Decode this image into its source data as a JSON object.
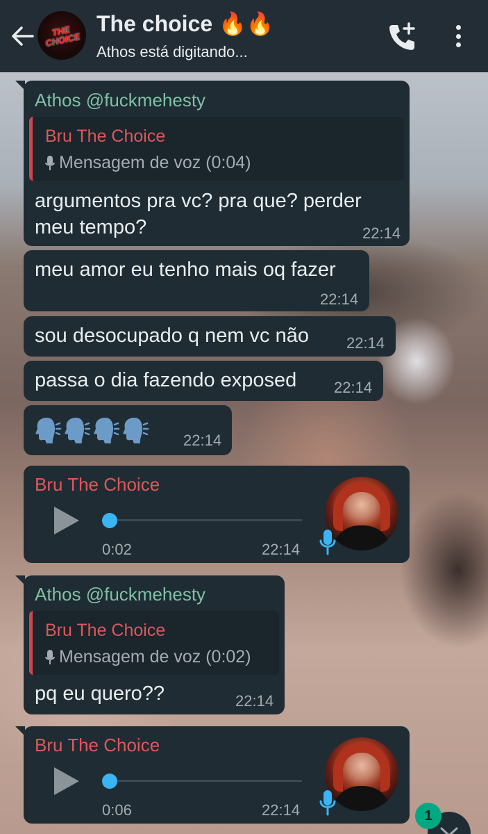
{
  "header": {
    "title": "The choice 🔥🔥",
    "subtitle": "Athos está digitando...",
    "avatar_logo": "THE CHOICE",
    "icons": [
      "back-arrow-icon",
      "add-call-icon",
      "more-vert-icon"
    ]
  },
  "messages": [
    {
      "sender": "Athos @fuckmehesty",
      "quote_sender": "Bru The Choice",
      "quote_text": "Mensagem de voz (0:04)",
      "text": "argumentos pra vc? pra que? perder meu tempo?",
      "time": "22:14"
    },
    {
      "text": "meu amor eu tenho mais oq fazer",
      "time": "22:14"
    },
    {
      "text": "sou desocupado q nem vc não",
      "time": "22:14"
    },
    {
      "text": "passa o dia fazendo exposed",
      "time": "22:14"
    },
    {
      "emoji_count": 4,
      "emoji_name": "speaking-head-emoji",
      "time": "22:14"
    },
    {
      "sender": "Bru The Choice",
      "voice_duration": "0:02",
      "voice_progress": 0,
      "time": "22:14"
    },
    {
      "sender": "Athos @fuckmehesty",
      "quote_sender": "Bru The Choice",
      "quote_text": "Mensagem de voz (0:02)",
      "text": "pq eu quero??",
      "time": "22:14"
    },
    {
      "sender": "Bru The Choice",
      "voice_duration": "0:06",
      "voice_progress": 0,
      "time": "22:14"
    }
  ],
  "unread_count": "1",
  "colors": {
    "header_bg": "#232d36",
    "bubble_bg": "#1f2c34",
    "sender_green": "#7fc1a4",
    "sender_red": "#e0575b",
    "voice_accent": "#3ab4f2",
    "badge": "#00a884"
  }
}
